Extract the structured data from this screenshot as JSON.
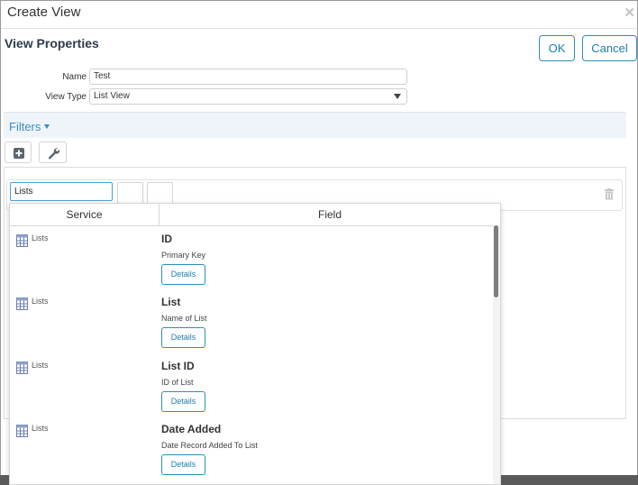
{
  "dialog": {
    "title": "Create View",
    "close_icon": "close-icon"
  },
  "header": {
    "section_title": "View Properties",
    "ok_label": "OK",
    "cancel_label": "Cancel"
  },
  "form": {
    "name_label": "Name",
    "name_value": "Test",
    "view_type_label": "View Type",
    "view_type_value": "List View"
  },
  "filters": {
    "label": "Filters",
    "add_icon": "plus-square-icon",
    "settings_icon": "wrench-icon",
    "search_value": "Lists",
    "delete_icon": "trash-icon"
  },
  "dropdown": {
    "columns": [
      "Service",
      "Field"
    ],
    "items": [
      {
        "service": "Lists",
        "field": "ID",
        "description": "Primary Key",
        "button": "Details"
      },
      {
        "service": "Lists",
        "field": "List",
        "description": "Name of List",
        "button": "Details"
      },
      {
        "service": "Lists",
        "field": "List ID",
        "description": "ID of List",
        "button": "Details"
      },
      {
        "service": "Lists",
        "field": "Date Added",
        "description": "Date Record Added To List",
        "button": "Details"
      }
    ]
  },
  "colors": {
    "accent": "#2a8fbd",
    "filters_bar": "#eef4fa",
    "title_text": "#2e3b4c"
  }
}
